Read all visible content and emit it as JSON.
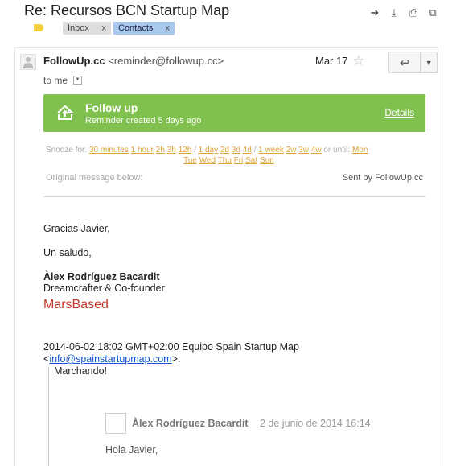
{
  "subject": "Re: Recursos BCN Startup Map",
  "toolbar": {
    "icons": [
      "forward-icon",
      "download-icon",
      "print-icon",
      "new-window-icon"
    ]
  },
  "labels": [
    {
      "name": "Inbox",
      "remove": "x"
    },
    {
      "name": "Contacts",
      "remove": "x"
    }
  ],
  "message": {
    "sender_name": "FollowUp.cc",
    "sender_email": "<reminder@followup.cc>",
    "date": "Mar 17",
    "to": "to me"
  },
  "followup": {
    "title": "Follow up",
    "subtitle": "Reminder created 5 days ago",
    "details": "Details"
  },
  "snooze": {
    "label": "Snooze for:",
    "options_line1": [
      "30 minutes",
      "1 hour",
      "2h",
      "3h",
      "12h",
      "1 day",
      "2d",
      "3d",
      "4d",
      "1 week",
      "2w",
      "3w",
      "4w"
    ],
    "or_until": "or until:",
    "days_line1": [
      "Mon"
    ],
    "days_line2": [
      "Tue",
      "Wed",
      "Thu",
      "Fri",
      "Sat",
      "Sun"
    ]
  },
  "original_label": "Original message below:",
  "sent_by": "Sent by FollowUp.cc",
  "body": {
    "greeting": "Gracias Javier,",
    "closing": "Un saludo,",
    "sig_name": "Àlex Rodríguez Bacardit",
    "sig_role": "Dreamcrafter & Co-founder",
    "sig_company": "MarsBased",
    "quote_header": "2014-06-02 18:02 GMT+02:00 Equipo Spain Startup Map",
    "quote_email_prefix": "<",
    "quote_email": "info@spainstartupmap.com",
    "quote_email_suffix": ">:",
    "quote_text": "Marchando!"
  },
  "inner": {
    "name": "Àlex Rodríguez Bacardit",
    "date": "2 de junio de 2014 16:14",
    "greeting": "Hola Javier,"
  }
}
